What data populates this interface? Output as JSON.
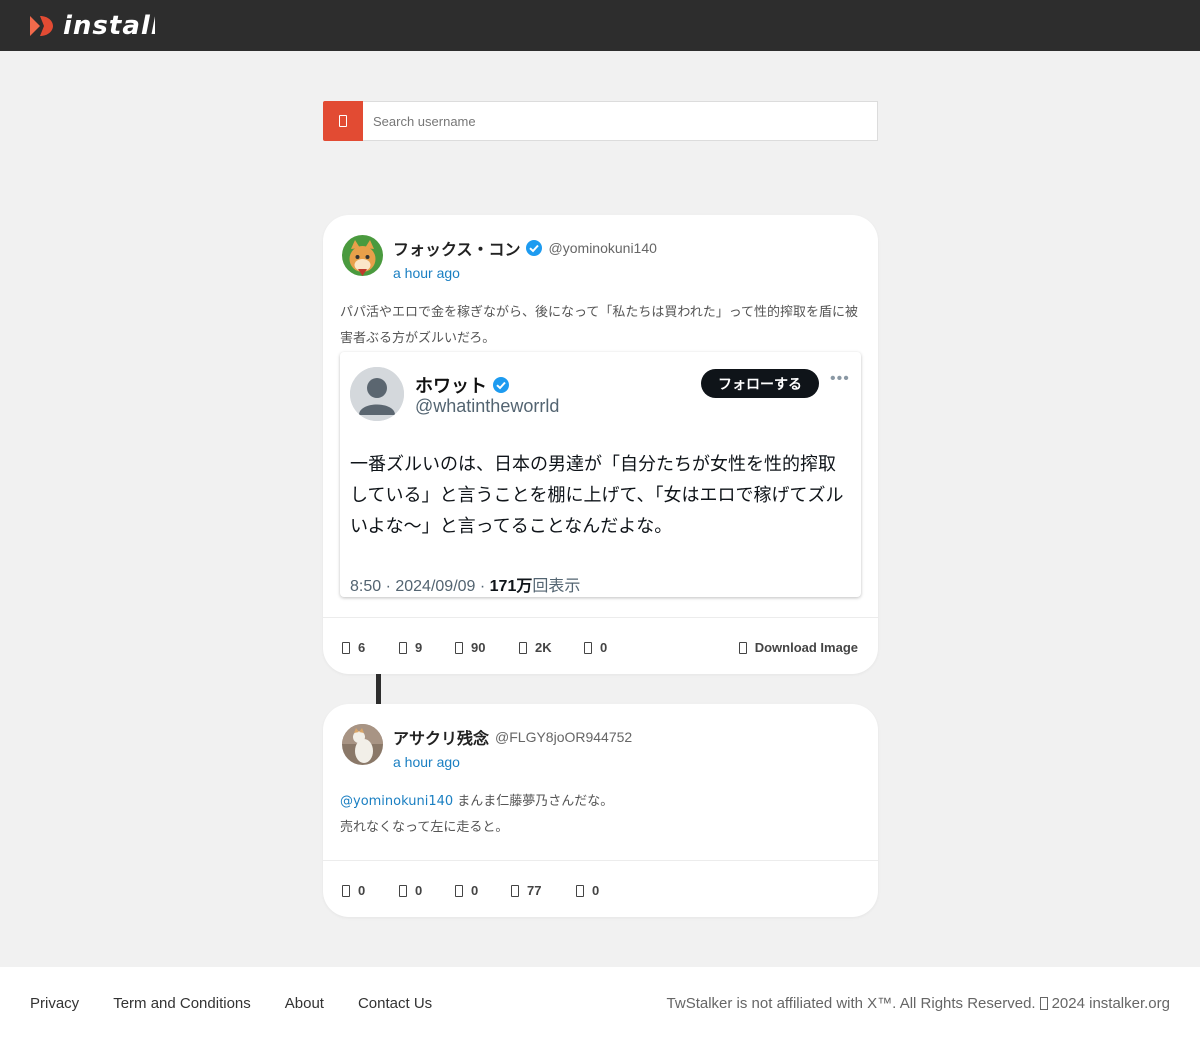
{
  "header": {
    "logo_text": "instalker"
  },
  "search": {
    "placeholder": "Search username",
    "button_icon": "search-icon"
  },
  "colors": {
    "accent": "#e24b33",
    "link": "#1a7fc2",
    "topbar": "#2d2d2d"
  },
  "posts": [
    {
      "display_name": "フォックス・コン",
      "handle": "@yominokuni140",
      "time": "a hour ago",
      "text": "パパ活やエロで金を稼ぎながら、後になって「私たちは買われた」って性的搾取を盾に被害者ぶる方がズルいだろ。",
      "embed": {
        "name": "ホワット",
        "handle": "@whatintheworrld",
        "follow_label": "フォローする",
        "body": "一番ズルいのは、日本の男達が「自分たちが女性を性的搾取している」と言うことを棚に上げて、「女はエロで稼げてズルいよな〜」と言ってることなんだよな。",
        "meta_date": "8:50 · 2024/09/09 · ",
        "meta_views": "171万",
        "meta_views_suffix": "回表示"
      },
      "stats": [
        "6",
        "9",
        "90",
        "2K",
        "0"
      ],
      "download_label": "Download Image"
    },
    {
      "display_name": "アサクリ残念",
      "handle": "@FLGY8joOR944752",
      "time": "a hour ago",
      "mention": "@yominokuni140",
      "text_line1": " まんま仁藤夢乃さんだな。",
      "text_line2": "売れなくなって左に走ると。",
      "stats": [
        "0",
        "0",
        "0",
        "77",
        "0"
      ]
    }
  ],
  "footer": {
    "links": [
      "Privacy",
      "Term and Conditions",
      "About",
      "Contact Us"
    ],
    "copyright_pre": "TwStalker is not affiliated with X™. All Rights Reserved.",
    "copyright_post": "2024 instalker.org"
  }
}
